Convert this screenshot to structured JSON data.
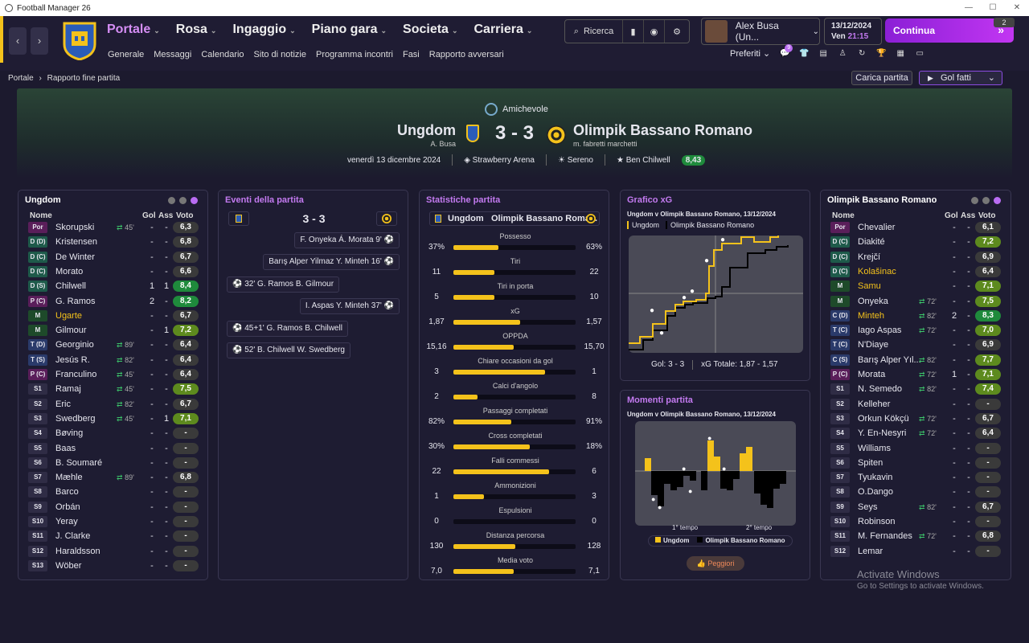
{
  "window": {
    "title": "Football Manager 26"
  },
  "nav": {
    "main": [
      {
        "label": "Portale"
      },
      {
        "label": "Rosa"
      },
      {
        "label": "Ingaggio"
      },
      {
        "label": "Piano gara"
      },
      {
        "label": "Societa"
      },
      {
        "label": "Carriera"
      }
    ],
    "sub": [
      "Generale",
      "Messaggi",
      "Calendario",
      "Sito di notizie",
      "Programma incontri",
      "Fasi",
      "Rapporto avversari"
    ]
  },
  "search": {
    "label": "Ricerca"
  },
  "user": {
    "name": "Alex Busa (Un..."
  },
  "date": {
    "date": "13/12/2024",
    "day": "Ven",
    "time": "21:15"
  },
  "continue": {
    "label": "Continua",
    "count": "2"
  },
  "prefs": {
    "label": "Preferiti",
    "badge": "9"
  },
  "breadcrumb": {
    "root": "Portale",
    "current": "Rapporto fine partita"
  },
  "actions": {
    "load": "Carica partita",
    "goals": "Gol fatti"
  },
  "match": {
    "competition": "Amichevole",
    "home": "Ungdom",
    "home_manager": "A. Busa",
    "away": "Olimpik Bassano Romano",
    "away_manager": "m. fabretti marchetti",
    "score": "3 - 3",
    "date": "venerdì 13 dicembre 2024",
    "stadium": "Strawberry Arena",
    "weather": "Sereno",
    "pom": "Ben Chilwell",
    "pom_rating": "8,43"
  },
  "home_panel": {
    "title": "Ungdom",
    "headers": {
      "name": "Nome",
      "gol": "Gol",
      "ass": "Ass",
      "voto": "Voto"
    },
    "players": [
      {
        "pos": "Por",
        "name": "Skorupski",
        "sub": "45'",
        "g": "-",
        "a": "-",
        "v": "6,3",
        "c": "#3a3a3a"
      },
      {
        "pos": "D (D)",
        "name": "Kristensen",
        "sub": "",
        "g": "-",
        "a": "-",
        "v": "6,8",
        "c": "#3a3a3a"
      },
      {
        "pos": "D (C)",
        "name": "De Winter",
        "sub": "",
        "g": "-",
        "a": "-",
        "v": "6,7",
        "c": "#3a3a3a"
      },
      {
        "pos": "D (C)",
        "name": "Morato",
        "sub": "",
        "g": "-",
        "a": "-",
        "v": "6,6",
        "c": "#3a3a3a"
      },
      {
        "pos": "D (S)",
        "name": "Chilwell",
        "sub": "",
        "g": "1",
        "a": "1",
        "v": "8,4",
        "c": "#1f8a3c"
      },
      {
        "pos": "P (C)",
        "name": "G. Ramos",
        "sub": "",
        "g": "2",
        "a": "-",
        "v": "8,2",
        "c": "#1f8a3c"
      },
      {
        "pos": "M",
        "name": "Ugarte",
        "sub": "",
        "g": "-",
        "a": "-",
        "v": "6,7",
        "c": "#3a3a3a",
        "hl": true
      },
      {
        "pos": "M",
        "name": "Gilmour",
        "sub": "",
        "g": "-",
        "a": "1",
        "v": "7,2",
        "c": "#5d8a1e"
      },
      {
        "pos": "T (D)",
        "name": "Georginio",
        "sub": "89'",
        "g": "-",
        "a": "-",
        "v": "6,4",
        "c": "#3a3a3a"
      },
      {
        "pos": "T (S)",
        "name": "Jesús R.",
        "sub": "82'",
        "g": "-",
        "a": "-",
        "v": "6,4",
        "c": "#3a3a3a"
      },
      {
        "pos": "P (C)",
        "name": "Franculino",
        "sub": "45'",
        "g": "-",
        "a": "-",
        "v": "6,4",
        "c": "#3a3a3a"
      },
      {
        "pos": "S1",
        "name": "Ramaj",
        "sub": "45'",
        "g": "-",
        "a": "-",
        "v": "7,5",
        "c": "#5d8a1e"
      },
      {
        "pos": "S2",
        "name": "Eric",
        "sub": "82'",
        "g": "-",
        "a": "-",
        "v": "6,7",
        "c": "#3a3a3a"
      },
      {
        "pos": "S3",
        "name": "Swedberg",
        "sub": "45'",
        "g": "-",
        "a": "1",
        "v": "7,1",
        "c": "#5d8a1e"
      },
      {
        "pos": "S4",
        "name": "Bøving",
        "sub": "",
        "g": "-",
        "a": "-",
        "v": "-",
        "c": "#3a3a3a"
      },
      {
        "pos": "S5",
        "name": "Baas",
        "sub": "",
        "g": "-",
        "a": "-",
        "v": "-",
        "c": "#3a3a3a"
      },
      {
        "pos": "S6",
        "name": "B. Soumaré",
        "sub": "",
        "g": "-",
        "a": "-",
        "v": "-",
        "c": "#3a3a3a"
      },
      {
        "pos": "S7",
        "name": "Mæhle",
        "sub": "89'",
        "g": "-",
        "a": "-",
        "v": "6,8",
        "c": "#3a3a3a"
      },
      {
        "pos": "S8",
        "name": "Barco",
        "sub": "",
        "g": "-",
        "a": "-",
        "v": "-",
        "c": "#3a3a3a"
      },
      {
        "pos": "S9",
        "name": "Orbán",
        "sub": "",
        "g": "-",
        "a": "-",
        "v": "-",
        "c": "#3a3a3a"
      },
      {
        "pos": "S10",
        "name": "Yeray",
        "sub": "",
        "g": "-",
        "a": "-",
        "v": "-",
        "c": "#3a3a3a"
      },
      {
        "pos": "S11",
        "name": "J. Clarke",
        "sub": "",
        "g": "-",
        "a": "-",
        "v": "-",
        "c": "#3a3a3a"
      },
      {
        "pos": "S12",
        "name": "Haraldsson",
        "sub": "",
        "g": "-",
        "a": "-",
        "v": "-",
        "c": "#3a3a3a"
      },
      {
        "pos": "S13",
        "name": "Wöber",
        "sub": "",
        "g": "-",
        "a": "-",
        "v": "-",
        "c": "#3a3a3a"
      }
    ]
  },
  "away_panel": {
    "title": "Olimpik Bassano Romano",
    "headers": {
      "name": "Nome",
      "gol": "Gol",
      "ass": "Ass",
      "voto": "Voto"
    },
    "players": [
      {
        "pos": "Por",
        "name": "Chevalier",
        "sub": "",
        "g": "-",
        "a": "-",
        "v": "6,1",
        "c": "#3a3a3a"
      },
      {
        "pos": "D (C)",
        "name": "Diakité",
        "sub": "",
        "g": "-",
        "a": "-",
        "v": "7,2",
        "c": "#5d8a1e"
      },
      {
        "pos": "D (C)",
        "name": "Krejčí",
        "sub": "",
        "g": "-",
        "a": "-",
        "v": "6,9",
        "c": "#3a3a3a"
      },
      {
        "pos": "D (C)",
        "name": "Kolašinac",
        "sub": "",
        "g": "-",
        "a": "-",
        "v": "6,4",
        "c": "#3a3a3a",
        "hl": true
      },
      {
        "pos": "M",
        "name": "Samu",
        "sub": "",
        "g": "-",
        "a": "-",
        "v": "7,1",
        "c": "#5d8a1e",
        "hl": true
      },
      {
        "pos": "M",
        "name": "Onyeka",
        "sub": "72'",
        "g": "-",
        "a": "-",
        "v": "7,5",
        "c": "#5d8a1e"
      },
      {
        "pos": "C (D)",
        "name": "Minteh",
        "sub": "82'",
        "g": "2",
        "a": "-",
        "v": "8,3",
        "c": "#1f8a3c",
        "hl": true
      },
      {
        "pos": "T (C)",
        "name": "Iago Aspas",
        "sub": "72'",
        "g": "-",
        "a": "-",
        "v": "7,0",
        "c": "#5d8a1e"
      },
      {
        "pos": "T (C)",
        "name": "N'Diaye",
        "sub": "",
        "g": "-",
        "a": "-",
        "v": "6,9",
        "c": "#3a3a3a"
      },
      {
        "pos": "C (S)",
        "name": "Barış Alper Yıl...",
        "sub": "82'",
        "g": "-",
        "a": "-",
        "v": "7,7",
        "c": "#5d8a1e"
      },
      {
        "pos": "P (C)",
        "name": "Morata",
        "sub": "72'",
        "g": "1",
        "a": "-",
        "v": "7,1",
        "c": "#5d8a1e"
      },
      {
        "pos": "S1",
        "name": "N. Semedo",
        "sub": "82'",
        "g": "-",
        "a": "-",
        "v": "7,4",
        "c": "#5d8a1e"
      },
      {
        "pos": "S2",
        "name": "Kelleher",
        "sub": "",
        "g": "-",
        "a": "-",
        "v": "-",
        "c": "#3a3a3a"
      },
      {
        "pos": "S3",
        "name": "Orkun Kökçü",
        "sub": "72'",
        "g": "-",
        "a": "-",
        "v": "6,7",
        "c": "#3a3a3a"
      },
      {
        "pos": "S4",
        "name": "Y. En-Nesyri",
        "sub": "72'",
        "g": "-",
        "a": "-",
        "v": "6,4",
        "c": "#3a3a3a"
      },
      {
        "pos": "S5",
        "name": "Williams",
        "sub": "",
        "g": "-",
        "a": "-",
        "v": "-",
        "c": "#3a3a3a"
      },
      {
        "pos": "S6",
        "name": "Spiten",
        "sub": "",
        "g": "-",
        "a": "-",
        "v": "-",
        "c": "#3a3a3a"
      },
      {
        "pos": "S7",
        "name": "Tyukavin",
        "sub": "",
        "g": "-",
        "a": "-",
        "v": "-",
        "c": "#3a3a3a"
      },
      {
        "pos": "S8",
        "name": "O.Dango",
        "sub": "",
        "g": "-",
        "a": "-",
        "v": "-",
        "c": "#3a3a3a"
      },
      {
        "pos": "S9",
        "name": "Seys",
        "sub": "82'",
        "g": "-",
        "a": "-",
        "v": "6,7",
        "c": "#3a3a3a"
      },
      {
        "pos": "S10",
        "name": "Robinson",
        "sub": "",
        "g": "-",
        "a": "-",
        "v": "-",
        "c": "#3a3a3a"
      },
      {
        "pos": "S11",
        "name": "M. Fernandes",
        "sub": "72'",
        "g": "-",
        "a": "-",
        "v": "6,8",
        "c": "#3a3a3a"
      },
      {
        "pos": "S12",
        "name": "Lemar",
        "sub": "",
        "g": "-",
        "a": "-",
        "v": "-",
        "c": "#3a3a3a"
      }
    ]
  },
  "events": {
    "title": "Eventi della partita",
    "score": "3 - 3",
    "items": [
      {
        "side": "away",
        "text": "F. Onyeka  Á. Morata  9'"
      },
      {
        "side": "away",
        "text": "Barış Alper Yilmaz  Y. Minteh  16'"
      },
      {
        "side": "home",
        "text": "32'  G. Ramos  B. Gilmour"
      },
      {
        "side": "away",
        "text": "I. Aspas  Y. Minteh  37'"
      },
      {
        "side": "home",
        "text": "45+1'  G. Ramos  B. Chilwell"
      },
      {
        "side": "home",
        "text": "52'  B. Chilwell  W. Swedberg"
      }
    ]
  },
  "stats": {
    "title": "Statistiche partita",
    "home": "Ungdom",
    "away": "Olimpik Bassano Roma...",
    "rows": [
      {
        "label": "Possesso",
        "h": "37%",
        "a": "63%",
        "hv": 37,
        "av": 63
      },
      {
        "label": "Tiri",
        "h": "11",
        "a": "22",
        "hv": 11,
        "av": 22
      },
      {
        "label": "Tiri in porta",
        "h": "5",
        "a": "10",
        "hv": 5,
        "av": 10
      },
      {
        "label": "xG",
        "h": "1,87",
        "a": "1,57",
        "hv": 1.87,
        "av": 1.57
      },
      {
        "label": "OPPDA",
        "h": "15,16",
        "a": "15,70",
        "hv": 15.16,
        "av": 15.7
      },
      {
        "label": "Chiare occasioni da gol",
        "h": "3",
        "a": "1",
        "hv": 3,
        "av": 1
      },
      {
        "label": "Calci d'angolo",
        "h": "2",
        "a": "8",
        "hv": 2,
        "av": 8
      },
      {
        "label": "Passaggi completati",
        "h": "82%",
        "a": "91%",
        "hv": 82,
        "av": 91
      },
      {
        "label": "Cross completati",
        "h": "30%",
        "a": "18%",
        "hv": 30,
        "av": 18
      },
      {
        "label": "Falli commessi",
        "h": "22",
        "a": "6",
        "hv": 22,
        "av": 6
      },
      {
        "label": "Ammonizioni",
        "h": "1",
        "a": "3",
        "hv": 1,
        "av": 3
      },
      {
        "label": "Espulsioni",
        "h": "0",
        "a": "0",
        "hv": 0,
        "av": 0
      },
      {
        "label": "Distanza percorsa",
        "h": "130",
        "a": "128",
        "hv": 130,
        "av": 128
      },
      {
        "label": "Media voto",
        "h": "7,0",
        "a": "7,1",
        "hv": 7.0,
        "av": 7.1
      }
    ]
  },
  "xg": {
    "title": "Grafico xG",
    "subtitle": "Ungdom v Olimpik Bassano Romano, 13/12/2024",
    "legend_home": "Ungdom",
    "legend_away": "Olimpik Bassano Romano",
    "gol": "Gol: 3 - 3",
    "totale": "xG  Totale: 1,87 - 1,57"
  },
  "momentum": {
    "title": "Momenti partita",
    "subtitle": "Ungdom v Olimpik Bassano Romano, 13/12/2024",
    "first": "1° tempo",
    "second": "2° tempo",
    "legend_home": "Ungdom",
    "legend_away": "Olimpik Bassano Romano",
    "button": "Peggiori"
  },
  "colors": {
    "home": "#f4c21b",
    "away": "#000000",
    "accent": "#b96cf2"
  },
  "watermark": {
    "line1": "Activate Windows",
    "line2": "Go to Settings to activate Windows."
  }
}
